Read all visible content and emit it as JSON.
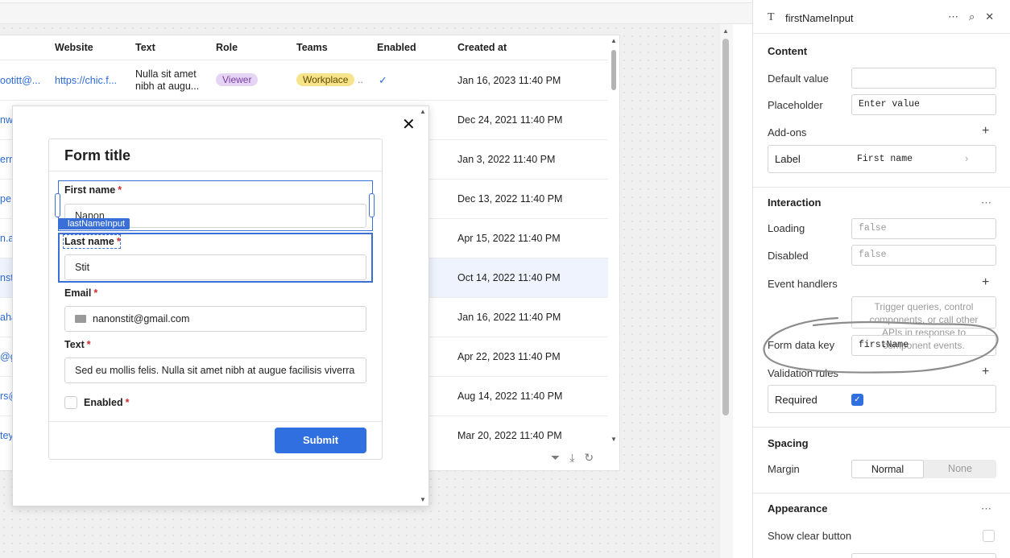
{
  "table": {
    "headers": [
      "Website",
      "Text",
      "Role",
      "Teams",
      "Enabled",
      "Created at"
    ],
    "rows": [
      {
        "email": "ootitt@...",
        "website": "https://chic.f...",
        "text": "Nulla sit amet nibh at augu...",
        "role": "Viewer",
        "team": "Workplace",
        "enabled": "✓",
        "created": "Jan 16, 2023 11:40 PM"
      },
      {
        "email": "nw",
        "created": "Dec 24, 2021 11:40 PM"
      },
      {
        "email": "err",
        "created": "Jan 3, 2022 11:40 PM"
      },
      {
        "email": "pe",
        "created": "Dec 13, 2022 11:40 PM"
      },
      {
        "email": "n.a",
        "created": "Apr 15, 2022 11:40 PM"
      },
      {
        "email": "nst",
        "created": "Oct 14, 2022 11:40 PM"
      },
      {
        "email": "aha",
        "created": "Jan 16, 2022 11:40 PM"
      },
      {
        "email": "@g",
        "created": "Apr 22, 2023 11:40 PM"
      },
      {
        "email": "rs@",
        "created": "Aug 14, 2022 11:40 PM"
      },
      {
        "email": "tey",
        "created": "Mar 20, 2022 11:40 PM"
      }
    ]
  },
  "form": {
    "title": "Form title",
    "first_name_label": "First name",
    "first_name_value": "Nanon",
    "selection_tag": "lastNameInput",
    "last_name_label": "Last name",
    "last_name_value": "Stit",
    "email_label": "Email",
    "email_value": "nanonstit@gmail.com",
    "text_label": "Text",
    "text_value": "Sed eu mollis felis. Nulla sit amet nibh at augue facilisis viverra",
    "enabled_label": "Enabled",
    "required_mark": "*",
    "submit_label": "Submit",
    "close_glyph": "✕"
  },
  "panel": {
    "title": "firstNameInput",
    "content": {
      "section": "Content",
      "default_value_label": "Default value",
      "default_value": "",
      "placeholder_label": "Placeholder",
      "placeholder_value": "Enter value",
      "addons_label": "Add-ons",
      "label_card_name": "Label",
      "label_card_value": "First name"
    },
    "interaction": {
      "section": "Interaction",
      "loading_label": "Loading",
      "loading_value": "false",
      "disabled_label": "Disabled",
      "disabled_value": "false",
      "event_handlers_label": "Event handlers",
      "event_handlers_hint": "Trigger queries, control components, or call other APIs in response to component events.",
      "form_data_key_label": "Form data key",
      "form_data_key_value": "firstName",
      "validation_rules_label": "Validation rules",
      "required_label": "Required",
      "required_checked": true
    },
    "spacing": {
      "section": "Spacing",
      "margin_label": "Margin",
      "options": [
        "Normal",
        "None"
      ],
      "selected": "Normal"
    },
    "appearance": {
      "section": "Appearance",
      "show_clear_label": "Show clear button"
    }
  },
  "colors": {
    "accent": "#2f6fe0",
    "link": "#2c6bd8",
    "role_pill": "#e5d4f4",
    "team_pill": "#f7e38a",
    "selected_row": "#eef3fd"
  }
}
